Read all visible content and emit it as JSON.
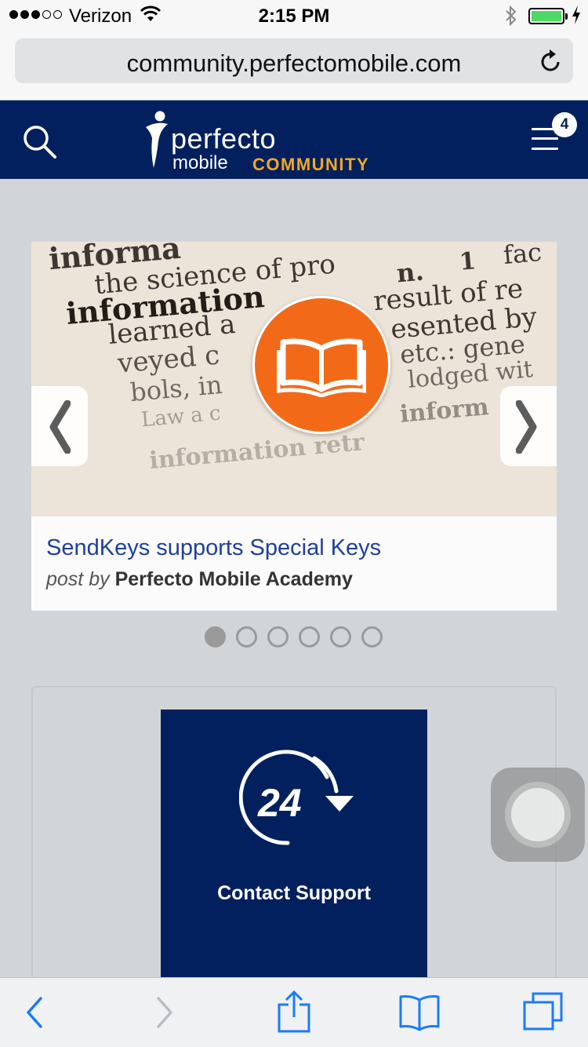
{
  "status_bar": {
    "carrier": "Verizon",
    "time": "2:15 PM",
    "signal_bars_filled": 3,
    "signal_bars_total": 5,
    "battery_color": "#4cd964"
  },
  "browser": {
    "url": "community.perfectomobile.com",
    "reload_icon": "reload-icon"
  },
  "site_header": {
    "logo_line1": "perfecto",
    "logo_line2": "mobile",
    "logo_line3": "COMMUNITY",
    "notification_count": "4",
    "brand_color": "#02205e",
    "accent_color": "#f5a623"
  },
  "carousel": {
    "hero_words": [
      "informa",
      "the science of pro",
      "information",
      "n.",
      "1",
      "fac",
      "result of re",
      "learned a",
      "esented by",
      "veyed c",
      "etc.: gene",
      "bols, in",
      "lodged wit",
      "inform",
      "Law a c",
      "information retr"
    ],
    "post_title": "SendKeys supports Special Keys",
    "post_by_prefix": "post by",
    "post_author": "Perfecto Mobile Academy",
    "slides_total": 6,
    "active_slide": 1,
    "icon_color": "#f26a17"
  },
  "support_tile": {
    "number": "24",
    "label": "Contact Support"
  },
  "toolbar": {
    "back_icon": "back-icon",
    "forward_icon": "forward-icon",
    "share_icon": "share-icon",
    "bookmarks_icon": "bookmarks-icon",
    "tabs_icon": "tabs-icon",
    "tint_color": "#1a7cf6"
  }
}
